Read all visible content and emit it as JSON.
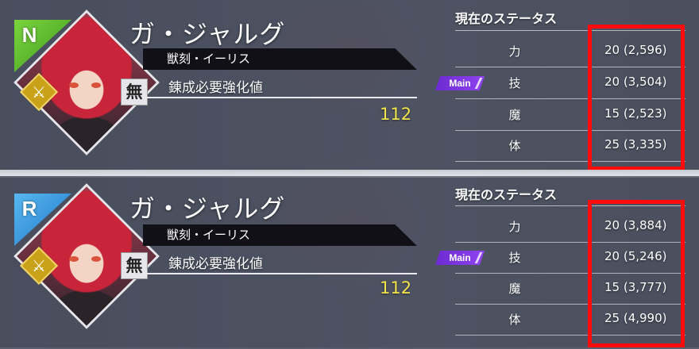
{
  "panels": [
    {
      "rarity": "N",
      "rarity_color": "#5ab82a",
      "character_name": "ガ・ジャルグ",
      "title": "獣刻・イーリス",
      "refine_label": "錬成必要強化値",
      "refine_value": "112",
      "weapon_badge_icon": "spear-icon",
      "element_badge": "無",
      "status_header": "現在のステータス",
      "main_tag": "Main",
      "stats": [
        {
          "name": "力",
          "value": "20 (2,596)"
        },
        {
          "name": "技",
          "value": "20 (3,504)"
        },
        {
          "name": "魔",
          "value": "15 (2,523)"
        },
        {
          "name": "体",
          "value": "25 (3,335)"
        }
      ]
    },
    {
      "rarity": "R",
      "rarity_color": "#2f8fde",
      "character_name": "ガ・ジャルグ",
      "title": "獣刻・イーリス",
      "refine_label": "錬成必要強化値",
      "refine_value": "112",
      "weapon_badge_icon": "spear-icon",
      "element_badge": "無",
      "status_header": "現在のステータス",
      "main_tag": "Main",
      "stats": [
        {
          "name": "力",
          "value": "20 (3,884)"
        },
        {
          "name": "技",
          "value": "20 (5,246)"
        },
        {
          "name": "魔",
          "value": "15 (3,777)"
        },
        {
          "name": "体",
          "value": "25 (4,990)"
        }
      ]
    }
  ],
  "highlight_color": "#ff0b0b"
}
